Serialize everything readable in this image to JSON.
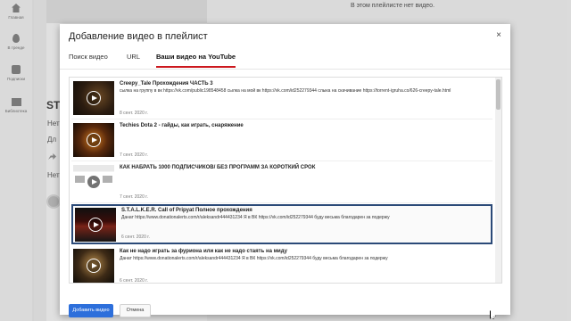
{
  "sidebar": {
    "items": [
      {
        "label": "Главная",
        "icon": "home-icon"
      },
      {
        "label": "В тренде",
        "icon": "trending-icon"
      },
      {
        "label": "Подписки",
        "icon": "subscriptions-icon"
      },
      {
        "label": "Библиотека",
        "icon": "library-icon"
      }
    ]
  },
  "background": {
    "empty_playlist": "В этом плейлисте нет видео.",
    "heading_fragment": "ST",
    "line1": "Нет",
    "line2": "Дл",
    "line3": "Нет"
  },
  "modal": {
    "title": "Добавление видео в плейлист",
    "close_glyph": "×",
    "tabs": [
      {
        "label": "Поиск видео",
        "active": false
      },
      {
        "label": "URL",
        "active": false
      },
      {
        "label": "Ваши видео на YouTube",
        "active": true
      }
    ],
    "videos": [
      {
        "title": "Creepy_Tale Прохождения ЧАСТЬ 3",
        "description": "сылка на группу в вк https://vk.com/public198548458 сылка на мой вк https://vk.com/id252279344 слыка на скачивание https://torrent-igruha.co/626-creepy-tale.html",
        "date": "8 сент. 2020 г.",
        "selected": false
      },
      {
        "title": "Techies Dota 2 - гайды, как играть, снаряжение",
        "description": "",
        "date": "7 сент. 2020 г.",
        "selected": false
      },
      {
        "title": "КАК НАБРАТЬ 1000 ПОДПИСЧИКОВ/ БЕЗ ПРОГРАММ ЗА КОРОТКИЙ СРОК",
        "description": "",
        "date": "7 сент. 2020 г.",
        "selected": false
      },
      {
        "title": "S.T.A.L.K.E.R. Call of Pripyat Полное прохождения",
        "description": "Данат https://www.donationalerts.com/r/aleksandr444431234 Я в ВК https://vk.com/id252279344 буду весьма благодарен за подержу",
        "date": "6 сент. 2020 г.",
        "selected": true
      },
      {
        "title": "Как не надо играть за фуриона или как не надо стаять на миду",
        "description": "Данат https://www.donationalerts.com/r/aleksandr444431234 Я в ВК https://vk.com/id252279344 буду весьма благодарен за подержу",
        "date": "6 сент. 2020 г.",
        "selected": false
      }
    ],
    "add_button": "Добавить видео",
    "cancel_button": "Отмена"
  },
  "colors": {
    "accent": "#2d6fdb",
    "active_tab": "#cc181e",
    "selection_border": "#2b4a78"
  }
}
